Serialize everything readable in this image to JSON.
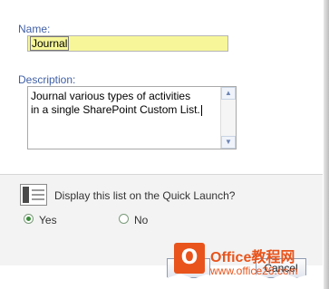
{
  "form": {
    "name_label": "Name:",
    "name_value": "Journal",
    "description_label": "Description:",
    "description_value": "Journal various types of activities\nin a single SharePoint Custom List.",
    "quick_launch_question": "Display this list on the Quick Launch?",
    "yes_label": "Yes",
    "no_label": "No",
    "selected_option": "Yes"
  },
  "buttons": {
    "cancel_label": "Cancel"
  },
  "watermark": {
    "brand": "Office教程网",
    "url": "www.office26.com"
  },
  "colors": {
    "label_blue": "#3f5fa6",
    "name_field_bg": "#f7f79a",
    "radio_selected": "#3a8a3a",
    "watermark_orange": "#e8541c"
  }
}
